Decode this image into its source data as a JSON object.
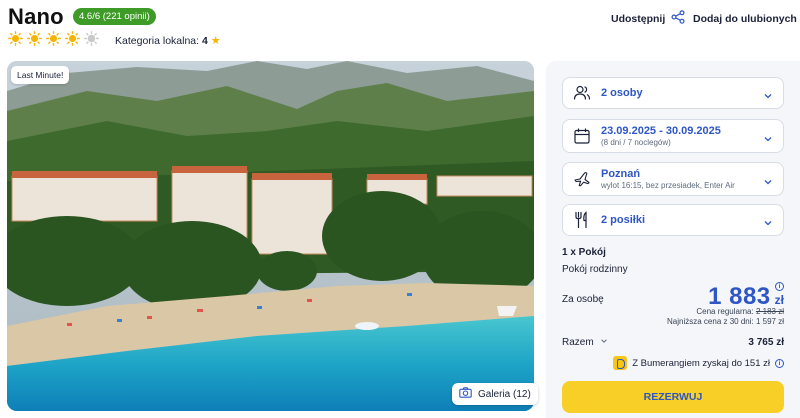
{
  "hotel": {
    "name": "Nano",
    "rating_badge": "4.6/6 (221 opinii)",
    "sun_rating": 4,
    "sun_rating_max": 5,
    "local_category_label": "Kategoria lokalna:",
    "local_category_value": "4"
  },
  "top_actions": {
    "share_label": "Udostępnij",
    "favorite_label": "Dodaj do ulubionych"
  },
  "hero": {
    "badge": "Last Minute!",
    "gallery_label": "Galeria (12)"
  },
  "booking": {
    "persons": "2 osoby",
    "dates": "23.09.2025 - 30.09.2025",
    "dates_sub": "(8 dni / 7 noclegów)",
    "departure_city": "Poznań",
    "departure_sub": "wylot 16:15, bez przesiadek, Enter Air",
    "meals": "2 posiłki",
    "rooms_label": "1 x Pokój",
    "room_type": "Pokój rodzinny",
    "per_person_label": "Za osobę",
    "price": "1 883",
    "currency": "zł",
    "regular_price_label": "Cena regularna:",
    "regular_price": "2 183 zł",
    "lowest_price_text": "Najniższa cena z 30 dni: 1 597 zł",
    "total_label": "Razem",
    "total_value": "3 765 zł",
    "bumerang_text": "Z Bumerangiem zyskaj do 151 zł",
    "reserve_label": "REZERWUJ"
  },
  "colors": {
    "accent_blue": "#2e56c4",
    "rating_green": "#3f9b27",
    "cta_yellow": "#f7cf26",
    "sun_yellow": "#f5b400"
  }
}
